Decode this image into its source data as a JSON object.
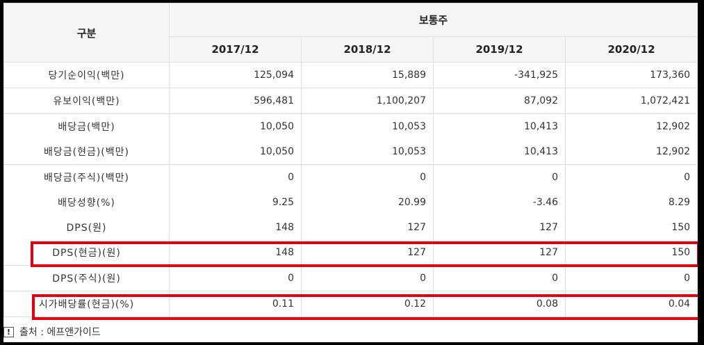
{
  "table": {
    "header_label": "구분",
    "group_header": "보통주",
    "years": [
      "2017/12",
      "2018/12",
      "2019/12",
      "2020/12"
    ],
    "rows": [
      {
        "label": "당기순이익(백만)",
        "values": [
          "125,094",
          "15,889",
          "-341,925",
          "173,360"
        ]
      },
      {
        "label": "유보이익(백만)",
        "values": [
          "596,481",
          "1,100,207",
          "87,092",
          "1,072,421"
        ]
      },
      {
        "label": "배당금(백만)",
        "values": [
          "10,050",
          "10,053",
          "10,413",
          "12,902"
        ]
      },
      {
        "label": "배당금(현금)(백만)",
        "values": [
          "10,050",
          "10,053",
          "10,413",
          "12,902"
        ]
      },
      {
        "label": "배당금(주식)(백만)",
        "values": [
          "0",
          "0",
          "0",
          "0"
        ]
      },
      {
        "label": "배당성향(%)",
        "values": [
          "9.25",
          "20.99",
          "-3.46",
          "8.29"
        ]
      },
      {
        "label": "DPS(원)",
        "values": [
          "148",
          "127",
          "127",
          "150"
        ]
      },
      {
        "label": "DPS(현금)(원)",
        "values": [
          "148",
          "127",
          "127",
          "150"
        ]
      },
      {
        "label": "DPS(주식)(원)",
        "values": [
          "0",
          "0",
          "0",
          "0"
        ]
      },
      {
        "label": "시가배당률(현금)(%)",
        "values": [
          "0.11",
          "0.12",
          "0.08",
          "0.04"
        ]
      }
    ]
  },
  "source": {
    "icon": "note-icon",
    "text": "출처 : 에프앤가이드"
  },
  "highlight_color": "#e3000f"
}
